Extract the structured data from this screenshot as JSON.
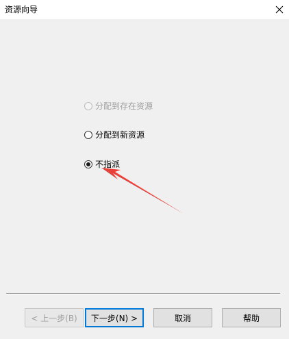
{
  "window": {
    "title": "资源向导",
    "close_icon": "close-icon"
  },
  "options": [
    {
      "label": "分配到存在资源",
      "checked": false,
      "disabled": true
    },
    {
      "label": "分配到新资源",
      "checked": false,
      "disabled": false
    },
    {
      "label": "不指派",
      "checked": true,
      "disabled": false
    }
  ],
  "buttons": {
    "back": "< 上一步(B)",
    "next": "下一步(N) >",
    "cancel": "取消",
    "help": "帮助"
  },
  "annotation": {
    "arrow_color": "#e8413a"
  }
}
